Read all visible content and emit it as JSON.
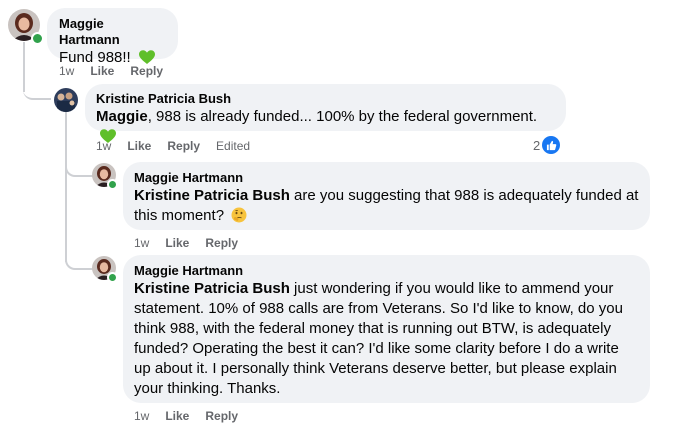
{
  "comments": [
    {
      "author": "Maggie Hartmann",
      "text": "Fund 988!!",
      "time": "1w",
      "like": "Like",
      "reply": "Reply"
    },
    {
      "author": "Kristine Patricia Bush",
      "mention": "Maggie",
      "text": ", 988 is already funded... 100% by the federal government.",
      "time": "1w",
      "like": "Like",
      "reply": "Reply",
      "edited": "Edited",
      "reaction_count": "2"
    },
    {
      "author": "Maggie Hartmann",
      "mention": "Kristine Patricia Bush",
      "text_line1": " are you suggesting that 988 is adequately funded at",
      "text_line2": "this moment?",
      "time": "1w",
      "like": "Like",
      "reply": "Reply"
    },
    {
      "author": "Maggie Hartmann",
      "mention": "Kristine Patricia Bush",
      "text_line1": " just wondering if you would like to ammend your",
      "text_line2": "statement. 10% of 988 calls are from Veterans. So I'd like to know, do you",
      "text_line3": "think 988, with the federal money that is running out BTW, is adequately",
      "text_line4": "funded? Operating the best it can? I'd like some clarity before I do a write",
      "text_line5": "up about it. I personally think Veterans deserve better, but please explain",
      "text_line6": "your thinking. Thanks.",
      "time": "1w",
      "like": "Like",
      "reply": "Reply"
    }
  ],
  "colors": {
    "bubble": "#f0f2f5",
    "meta": "#65676b",
    "like_blue": "#1877f2",
    "online": "#31a24c",
    "heart": "#5fbf2a"
  }
}
